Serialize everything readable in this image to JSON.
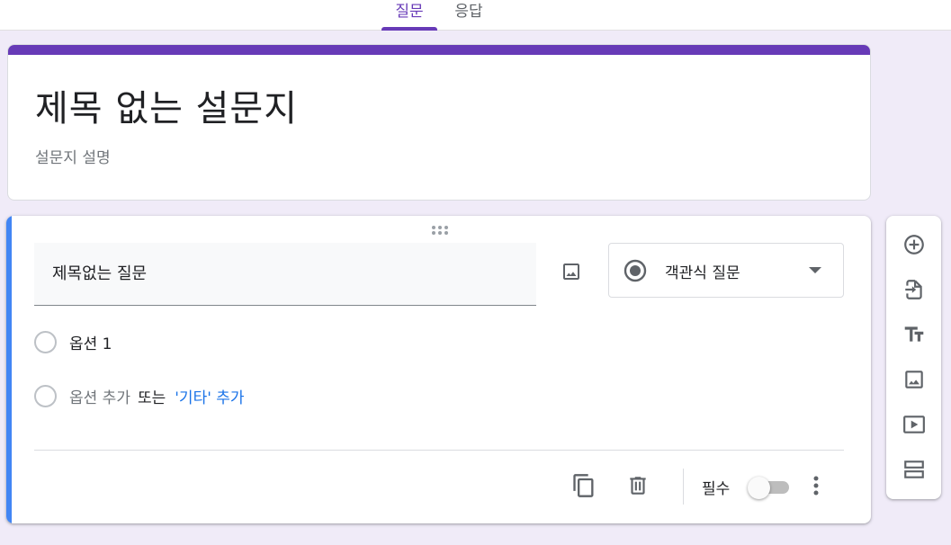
{
  "tabs": [
    {
      "label": "질문",
      "active": true
    },
    {
      "label": "응답",
      "active": false
    }
  ],
  "form": {
    "title": "제목 없는 설문지",
    "description": "설문지 설명"
  },
  "question": {
    "title": "제목없는 질문",
    "type_label": "객관식 질문",
    "options": [
      {
        "label": "옵션 1"
      }
    ],
    "add_option": {
      "add_label": "옵션 추가",
      "or_label": "또는",
      "other_label": "'기타' 추가"
    },
    "required_label": "필수",
    "required": false
  },
  "side_toolbar": {
    "icons": [
      "add-question-icon",
      "import-questions-icon",
      "add-title-icon",
      "add-image-icon",
      "add-video-icon",
      "add-section-icon"
    ]
  },
  "colors": {
    "accent": "#673ab7",
    "active_card": "#4285f4",
    "background": "#f0ebf8",
    "link": "#1a73e8"
  }
}
